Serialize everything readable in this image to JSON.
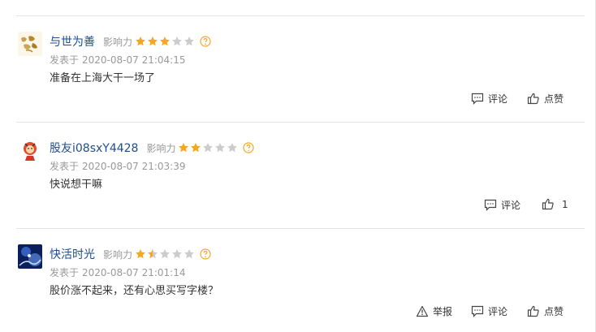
{
  "comments": [
    {
      "username": "与世为善",
      "influence_label": "影响力",
      "influence_stars": 3,
      "posted_prefix": "发表于",
      "posted_time": "2020-08-07 21:04:15",
      "text": "准备在上海大干一场了",
      "actions": {
        "comment": "评论",
        "like": "点赞"
      }
    },
    {
      "username": "股友i08sxY4428",
      "influence_label": "影响力",
      "influence_stars": 2,
      "posted_prefix": "发表于",
      "posted_time": "2020-08-07 21:03:39",
      "text": "快说想干嘛",
      "actions": {
        "comment": "评论",
        "like": "1"
      }
    },
    {
      "username": "快活时光",
      "influence_label": "影响力",
      "influence_stars": 1.5,
      "posted_prefix": "发表于",
      "posted_time": "2020-08-07 21:01:14",
      "text": "股价涨不起来，还有心思买写字楼？",
      "actions": {
        "report": "举报",
        "comment": "评论",
        "like": "点赞"
      }
    }
  ],
  "colors": {
    "username": "#1e4e8c",
    "star_on": "#f6a623",
    "star_off": "#cccccc",
    "meta": "#999999"
  },
  "icons": [
    "comment-icon",
    "thumbs-up-icon",
    "warning-icon",
    "help-icon",
    "star-icon"
  ]
}
